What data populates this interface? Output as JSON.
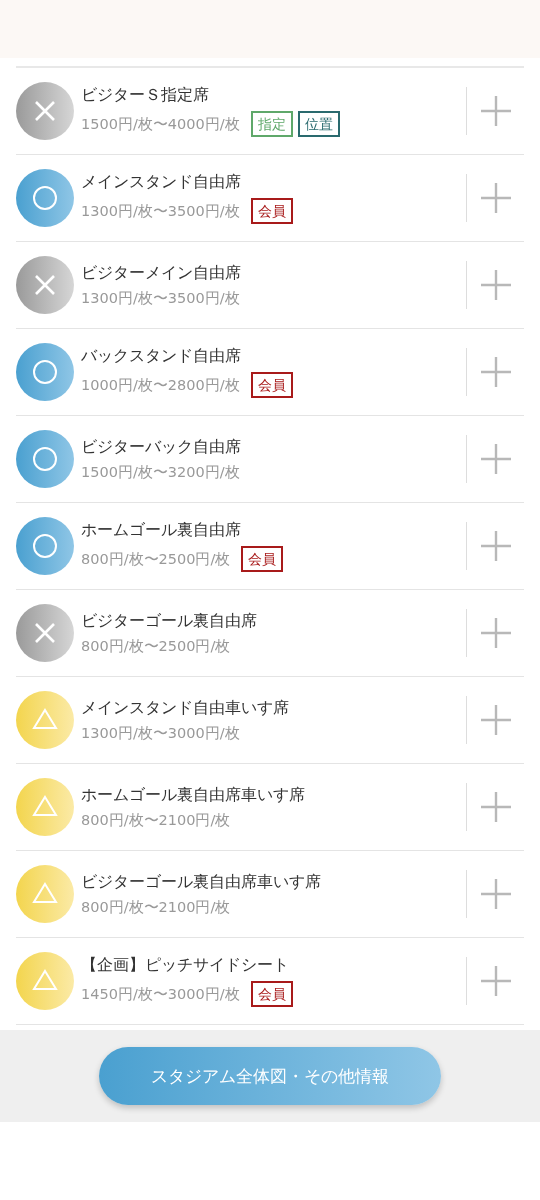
{
  "seats": [
    {
      "name": "ビジターＳ指定席",
      "price": "1500円/枚〜4000円/枚",
      "kind": "sold_out",
      "tags": [
        {
          "label": "指定",
          "color": "#5fa86a"
        },
        {
          "label": "位置",
          "color": "#2a6a6e"
        }
      ]
    },
    {
      "name": "メインスタンド自由席",
      "price": "1300円/枚〜3500円/枚",
      "kind": "available",
      "tags": [
        {
          "label": "会員",
          "color": "#a81a1a"
        }
      ]
    },
    {
      "name": "ビジターメイン自由席",
      "price": "1300円/枚〜3500円/枚",
      "kind": "sold_out"
    },
    {
      "name": "バックスタンド自由席",
      "price": "1000円/枚〜2800円/枚",
      "kind": "available",
      "tags": [
        {
          "label": "会員",
          "color": "#a81a1a"
        }
      ]
    },
    {
      "name": "ビジターバック自由席",
      "price": "1500円/枚〜3200円/枚",
      "kind": "available"
    },
    {
      "name": "ホームゴール裏自由席",
      "price": "800円/枚〜2500円/枚",
      "kind": "available",
      "tags": [
        {
          "label": "会員",
          "color": "#a81a1a"
        }
      ]
    },
    {
      "name": "ビジターゴール裏自由席",
      "price": "800円/枚〜2500円/枚",
      "kind": "sold_out"
    },
    {
      "name": "メインスタンド自由車いす席",
      "price": "1300円/枚〜3000円/枚",
      "kind": "few"
    },
    {
      "name": "ホームゴール裏自由席車いす席",
      "price": "800円/枚〜2100円/枚",
      "kind": "few"
    },
    {
      "name": "ビジターゴール裏自由席車いす席",
      "price": "800円/枚〜2100円/枚",
      "kind": "few"
    },
    {
      "name": "【企画】ピッチサイドシート",
      "price": "1450円/枚〜3000円/枚",
      "kind": "few",
      "tags": [
        {
          "label": "会員",
          "color": "#a81a1a"
        }
      ]
    }
  ],
  "footer_button": "スタジアム全体図・その他情報"
}
